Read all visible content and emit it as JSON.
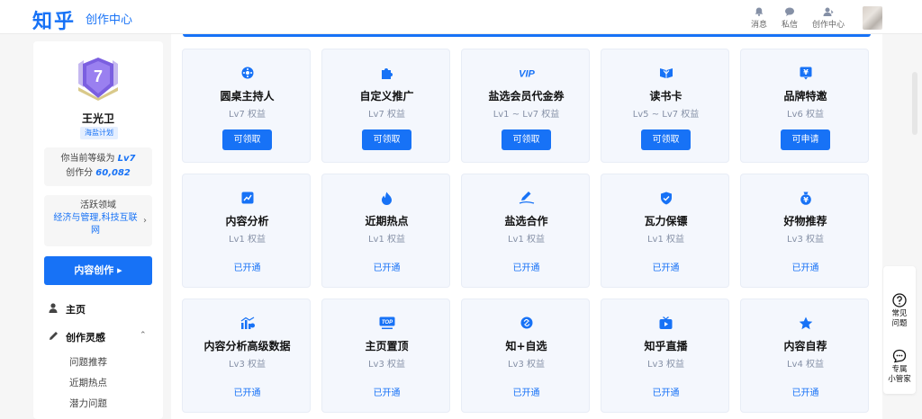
{
  "header": {
    "logo": "知乎",
    "subtitle": "创作中心",
    "items": [
      {
        "label": "消息",
        "icon": "bell-icon"
      },
      {
        "label": "私信",
        "icon": "chat-icon"
      },
      {
        "label": "创作中心",
        "icon": "creator-icon"
      }
    ]
  },
  "sidebar": {
    "badge_level": "7",
    "username": "王光卫",
    "plan_tag": "海盐计划",
    "level_prefix": "你当前等级为",
    "level_value": "Lv7",
    "score_prefix": "创作分",
    "score_value": "60,082",
    "field_title": "活跃领域",
    "field_value": "经济与管理,科技互联网",
    "create_button": "内容创作 ▸",
    "nav": [
      {
        "label": "主页",
        "icon": "user-icon"
      },
      {
        "label": "创作灵感",
        "icon": "pen-icon"
      }
    ],
    "sub_items": [
      "问题推荐",
      "近期热点",
      "潜力问题",
      "…"
    ]
  },
  "cards": [
    {
      "title": "圆桌主持人",
      "sub": "Lv7 权益",
      "action": "可领取",
      "icon": "roundtable-icon"
    },
    {
      "title": "自定义推广",
      "sub": "Lv7 权益",
      "action": "可领取",
      "icon": "puzzle-icon"
    },
    {
      "title": "盐选会员代金券",
      "sub": "Lv1 ~ Lv7 权益",
      "action": "可领取",
      "icon": "vip-icon"
    },
    {
      "title": "读书卡",
      "sub": "Lv5 ~ Lv7 权益",
      "action": "可领取",
      "icon": "book-icon"
    },
    {
      "title": "品牌特邀",
      "sub": "Lv6 权益",
      "action": "可申请",
      "icon": "brand-icon"
    },
    {
      "title": "内容分析",
      "sub": "Lv1 权益",
      "status": "已开通",
      "icon": "analytics-icon"
    },
    {
      "title": "近期热点",
      "sub": "Lv1 权益",
      "status": "已开通",
      "icon": "fire-icon"
    },
    {
      "title": "盐选合作",
      "sub": "Lv1 权益",
      "status": "已开通",
      "icon": "pencil-icon"
    },
    {
      "title": "瓦力保镖",
      "sub": "Lv1 权益",
      "status": "已开通",
      "icon": "shield-icon"
    },
    {
      "title": "好物推荐",
      "sub": "Lv3 权益",
      "status": "已开通",
      "icon": "moneybag-icon"
    },
    {
      "title": "内容分析高级数据",
      "sub": "Lv3 权益",
      "status": "已开通",
      "icon": "barchart-icon"
    },
    {
      "title": "主页置顶",
      "sub": "Lv3 权益",
      "status": "已开通",
      "icon": "top-icon"
    },
    {
      "title": "知+自选",
      "sub": "Lv3 权益",
      "status": "已开通",
      "icon": "link-icon"
    },
    {
      "title": "知乎直播",
      "sub": "Lv3 权益",
      "status": "已开通",
      "icon": "live-icon"
    },
    {
      "title": "内容自荐",
      "sub": "Lv4 权益",
      "status": "已开通",
      "icon": "star-icon"
    }
  ],
  "float": [
    {
      "label": "常见\n问题",
      "icon": "question-icon"
    },
    {
      "label": "专属\n小管家",
      "icon": "assistant-icon"
    }
  ],
  "colors": {
    "accent": "#1772f6",
    "card_bg": "#f4f7fd",
    "muted": "#8590a6"
  }
}
